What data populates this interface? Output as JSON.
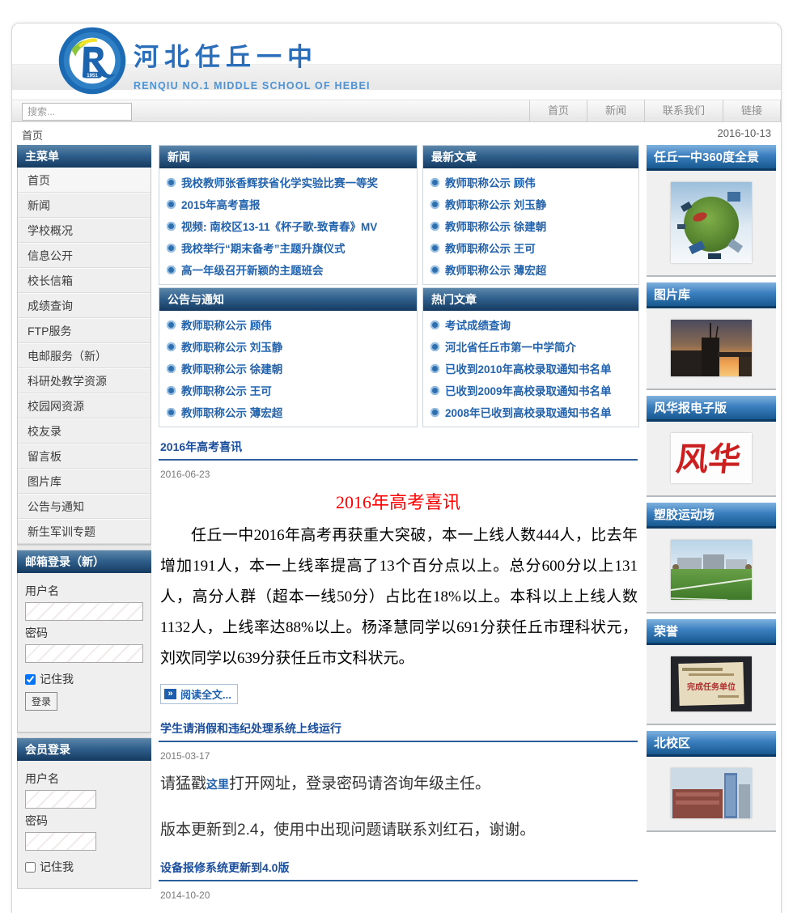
{
  "colors": {
    "accent_blue": "#1d5fae",
    "header_dark_bottom": "#153a60",
    "header_bright_top": "#7fb2dd",
    "red_heading": "#ff0000"
  },
  "header": {
    "site_title": "河北任丘一中",
    "site_subtitle": "RENQIU NO.1 MIDDLE SCHOOL OF HEBEI",
    "logo_year": "1951"
  },
  "search": {
    "placeholder": "搜索..."
  },
  "topnav": {
    "items": [
      {
        "label": "首页"
      },
      {
        "label": "新闻"
      },
      {
        "label": "联系我们"
      },
      {
        "label": "链接"
      }
    ]
  },
  "breadcrumb": {
    "current": "首页",
    "date": "2016-10-13"
  },
  "sidebar": {
    "main_menu": {
      "title": "主菜单",
      "items": [
        "首页",
        "新闻",
        "学校概况",
        "信息公开",
        "校长信箱",
        "成绩查询",
        "FTP服务",
        "电邮服务（新）",
        "科研处教学资源",
        "校园网资源",
        "校友录",
        "留言板",
        "图片库",
        "公告与通知",
        "新生军训专题"
      ]
    },
    "mail_login": {
      "title": "邮箱登录（新）",
      "username_label": "用户名",
      "password_label": "密码",
      "remember_label": "记住我",
      "login_button": "登录"
    },
    "member_login": {
      "title": "会员登录",
      "username_label": "用户名",
      "password_label": "密码",
      "remember_label": "记住我"
    }
  },
  "panels": {
    "news": {
      "title": "新闻",
      "items": [
        "我校教师张香辉获省化学实验比赛一等奖",
        "2015年高考喜报",
        "视频: 南校区13-11《杯子歌-致青春》MV",
        "我校举行“期末备考”主题升旗仪式",
        "高一年级召开新颖的主题班会"
      ]
    },
    "latest": {
      "title": "最新文章",
      "items": [
        "教师职称公示 顾伟",
        "教师职称公示 刘玉静",
        "教师职称公示 徐建朝",
        "教师职称公示 王可",
        "教师职称公示 薄宏超"
      ]
    },
    "notices": {
      "title": "公告与通知",
      "items": [
        "教师职称公示 顾伟",
        "教师职称公示 刘玉静",
        "教师职称公示 徐建朝",
        "教师职称公示 王可",
        "教师职称公示 薄宏超"
      ]
    },
    "hot": {
      "title": "热门文章",
      "items": [
        "考试成绩查询",
        "河北省任丘市第一中学简介",
        "已收到2010年高校录取通知书名单",
        "已收到2009年高校录取通知书名单",
        "2008年已收到高校录取通知书名单"
      ]
    }
  },
  "articles": {
    "a1": {
      "title": "2016年高考喜讯",
      "date": "2016-06-23",
      "heading": "2016年高考喜讯",
      "body": "任丘一中2016年高考再获重大突破，本一上线人数444人，比去年增加191人，本一上线率提高了13个百分点以上。总分600分以上131人，高分人群（超本一线50分）占比在18%以上。本科以上上线人数1132人，上线率达88%以上。杨泽慧同学以691分获任丘市理科状元，刘欢同学以639分获任丘市文科状元。",
      "read_more": "阅读全文..."
    },
    "a2": {
      "title": "学生请消假和违纪处理系统上线运行",
      "date": "2015-03-17",
      "p1_before": "请猛戳",
      "p1_link": "这里",
      "p1_after": "打开网址，登录密码请咨询年级主任。",
      "p2": "版本更新到2.4，使用中出现问题请联系刘红石，谢谢。"
    },
    "a3": {
      "title": "设备报修系统更新到4.0版",
      "date": "2014-10-20"
    }
  },
  "right_sidebar": {
    "sections": [
      {
        "title": "任丘一中360度全景"
      },
      {
        "title": "图片库"
      },
      {
        "title": "风华报电子版",
        "image_text": "风华"
      },
      {
        "title": "塑胶运动场"
      },
      {
        "title": "荣誉",
        "plaque_text": "完成任务单位"
      },
      {
        "title": "北校区"
      }
    ]
  }
}
